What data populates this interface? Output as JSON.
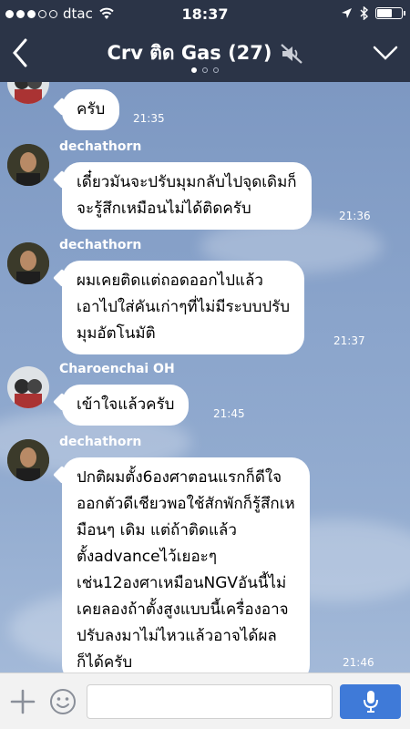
{
  "status": {
    "carrier": "dtac",
    "time": "18:37",
    "signal_filled": 3,
    "signal_total": 5,
    "battery_level": 0.65
  },
  "header": {
    "title": "Crv ติด Gas (27)",
    "page_index": 0,
    "page_count": 3
  },
  "messages": [
    {
      "sender": "",
      "text": "ครับ",
      "time": "21:35"
    },
    {
      "sender": "dechathorn",
      "text": "เดี๋ยวมันจะปรับมุมกลับไปจุดเดิมก็\nจะรู้สึกเหมือนไม่ได้ติดครับ",
      "time": "21:36"
    },
    {
      "sender": "dechathorn",
      "text": "ผมเคยติดแต่ถอดออกไปแล้ว\nเอาไปใส่คันเก่าๆที่ไม่มีระบบปรับ\nมุมอัตโนมัติ",
      "time": "21:37"
    },
    {
      "sender": "Charoenchai OH",
      "text": "เข้าใจแล้วครับ",
      "time": "21:45"
    },
    {
      "sender": "dechathorn",
      "text": "ปกติผมตั้ง6องศาตอนแรกก็ดีใจ\nออกตัวดีเชียวพอใช้สักพักก็รู้สึกเห\nมือนๆ เดิม แต่ถ้าติดแล้ว\nตั้งadvanceไว้เยอะๆ\nเช่น12องศาเหมือนNGVอันนี้ไม่\nเคยลองถ้าตั้งสูงแบบนี้เครื่องอาจ\nปรับลงมาไม่ไหวแล้วอาจได้ผล\nก็ได้ครับ",
      "time": "21:46"
    }
  ],
  "input": {
    "placeholder": ""
  },
  "colors": {
    "header_bg": "#2b3447",
    "send_accent": "#3f7ad8"
  }
}
